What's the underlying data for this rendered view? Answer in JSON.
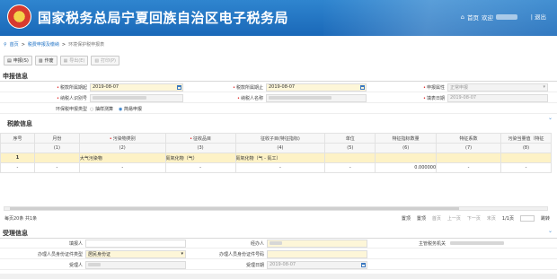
{
  "header": {
    "title": "国家税务总局宁夏回族自治区电子税务局",
    "home": "首页",
    "welcome": "欢迎",
    "logout": "退出"
  },
  "breadcrumb": {
    "home": "首页",
    "section": "税费申报及缴纳",
    "current": "环境保护税申报表"
  },
  "toolbar": {
    "declare": "申报(S)",
    "reset": "作废",
    "import": "导出(E)",
    "print": "打印(P)"
  },
  "sections": {
    "declare_info": "申报信息",
    "tax_info": "税款信息",
    "accept_info": "受理信息"
  },
  "declare": {
    "row1": [
      {
        "label": "税款所属期起",
        "value": "2019-08-07"
      },
      {
        "label": "税款所属期止",
        "value": "2019-08-07"
      },
      {
        "label": "申报属性",
        "value": "正常申报"
      }
    ],
    "row2": [
      {
        "label": "纳税人识别号",
        "value": ""
      },
      {
        "label": "纳税人名称",
        "value": ""
      },
      {
        "label": "填表日期",
        "value": "2019-08-07"
      }
    ],
    "row3": {
      "label": "环保税申报类型",
      "opt1": "抽样测算",
      "opt2": "简易申报"
    }
  },
  "tax_table": {
    "headers": [
      "序号",
      "月份",
      "污染物类别",
      "征收品目",
      "征收子目(特征指标)",
      "单位",
      "特征指标数量",
      "特征系数",
      "污染当量值（特征"
    ],
    "subheaders": [
      "",
      "(1)",
      "(2)",
      "(3)",
      "(4)",
      "(5)",
      "(6)",
      "(7)",
      "(8)"
    ],
    "rows": [
      [
        "1",
        "",
        "大气污染物",
        "氮氧化物（气）",
        "氮氧化物（气 - 氮工）",
        "",
        "",
        "",
        ""
      ],
      [
        "-",
        "-",
        "-",
        "-",
        "-",
        "-",
        "0.000000",
        "-",
        "-"
      ]
    ]
  },
  "pager": {
    "left": "每页20条 共1条",
    "first": "首页",
    "prev": "上一页",
    "next": "下一页",
    "last": "末页",
    "page": "1/1页",
    "go": "跳转",
    "top": "置顶",
    "bottom": "置顶"
  },
  "accept": {
    "row1": [
      {
        "label": "填报人",
        "value": ""
      },
      {
        "label": "经办人",
        "value": ""
      },
      {
        "label": "主管税务机关",
        "value": ""
      }
    ],
    "row2": [
      {
        "label": "办理人员身份证件类型",
        "value": "居民身份证"
      },
      {
        "label": "办理人员身份证件号码",
        "value": ""
      }
    ],
    "row3": [
      {
        "label": "受理人",
        "value": ""
      },
      {
        "label": "受理日期",
        "value": "2019-08-07"
      }
    ]
  },
  "colors": {
    "header": "#1a68b8",
    "link": "#1a6fc4",
    "highlight": "#fdf2c6",
    "required": "#e02020"
  }
}
